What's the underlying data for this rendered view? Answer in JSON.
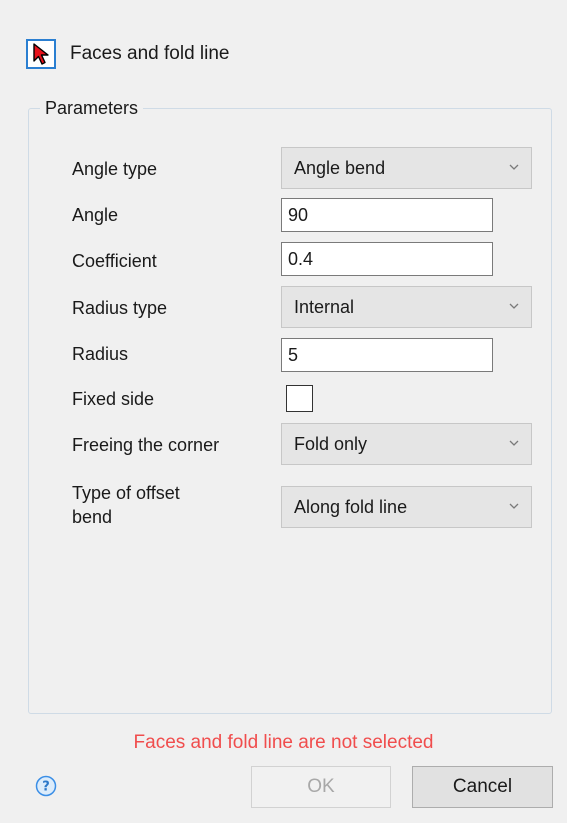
{
  "header": {
    "title": "Faces and fold line",
    "select_icon": "cursor-arrow-icon"
  },
  "parameters": {
    "legend": "Parameters",
    "angle_type": {
      "label": "Angle type",
      "value": "Angle bend"
    },
    "angle": {
      "label": "Angle",
      "value": "90"
    },
    "coefficient": {
      "label": "Coefficient",
      "value": "0.4"
    },
    "radius_type": {
      "label": "Radius type",
      "value": "Internal"
    },
    "radius": {
      "label": "Radius",
      "value": "5"
    },
    "fixed_side": {
      "label": "Fixed side",
      "checked": false
    },
    "freeing_corner": {
      "label": "Freeing the corner",
      "value": "Fold only"
    },
    "offset_bend": {
      "label_line1": "Type of offset",
      "label_line2": "bend",
      "value": "Along fold line"
    }
  },
  "status": {
    "message": "Faces and fold line are not selected",
    "color": "#f04d4d"
  },
  "footer": {
    "help_icon": "help-icon",
    "ok_label": "OK",
    "cancel_label": "Cancel"
  },
  "colors": {
    "accent": "#2b7fd1",
    "background": "#f0f0f0"
  }
}
